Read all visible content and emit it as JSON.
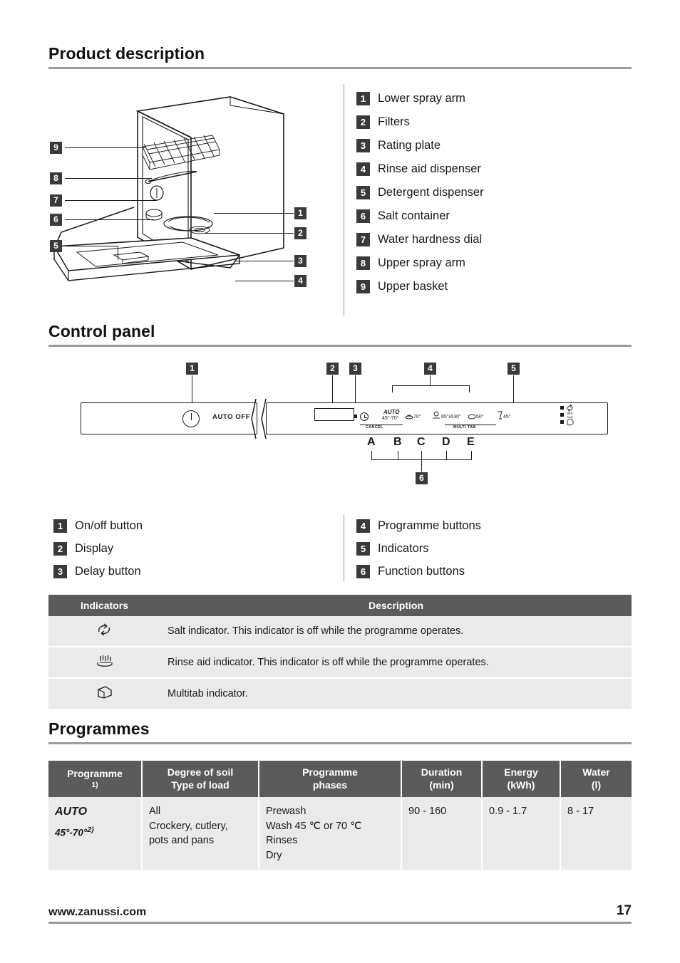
{
  "sections": {
    "product_description": "Product description",
    "control_panel": "Control panel",
    "programmes": "Programmes"
  },
  "product_legend": [
    {
      "n": "1",
      "label": "Lower spray arm"
    },
    {
      "n": "2",
      "label": "Filters"
    },
    {
      "n": "3",
      "label": "Rating plate"
    },
    {
      "n": "4",
      "label": "Rinse aid dispenser"
    },
    {
      "n": "5",
      "label": "Detergent dispenser"
    },
    {
      "n": "6",
      "label": "Salt container"
    },
    {
      "n": "7",
      "label": "Water hardness dial"
    },
    {
      "n": "8",
      "label": "Upper spray arm"
    },
    {
      "n": "9",
      "label": "Upper basket"
    }
  ],
  "diagram_callouts": {
    "left": [
      "9",
      "8",
      "7",
      "6",
      "5"
    ],
    "right": [
      "1",
      "2",
      "3",
      "4"
    ]
  },
  "control_panel": {
    "callouts": [
      "1",
      "2",
      "3",
      "4",
      "5",
      "6"
    ],
    "letters": [
      "A",
      "B",
      "C",
      "D",
      "E"
    ],
    "panel_labels": {
      "auto_off": "AUTO OFF",
      "auto": "AUTO",
      "auto_range": "45°-70°",
      "p70": "70°",
      "p65a30": "65°/A30°",
      "p50": "50°",
      "p45": "45°",
      "cancel": "CANCEL",
      "multitab": "MULTI TAB"
    },
    "legend_left": [
      {
        "n": "1",
        "label": "On/off button"
      },
      {
        "n": "2",
        "label": "Display"
      },
      {
        "n": "3",
        "label": "Delay button"
      }
    ],
    "legend_right": [
      {
        "n": "4",
        "label": "Programme buttons"
      },
      {
        "n": "5",
        "label": "Indicators"
      },
      {
        "n": "6",
        "label": "Function buttons"
      }
    ]
  },
  "indicators_table": {
    "headers": [
      "Indicators",
      "Description"
    ],
    "rows": [
      {
        "icon": "salt-indicator-icon",
        "description": "Salt indicator. This indicator is off while the programme operates."
      },
      {
        "icon": "rinse-aid-indicator-icon",
        "description": "Rinse aid indicator. This indicator is off while the programme operates."
      },
      {
        "icon": "multitab-indicator-icon",
        "description": "Multitab indicator."
      }
    ]
  },
  "programmes_table": {
    "headers": [
      {
        "l1": "Programme",
        "l2": "",
        "sup": "1)"
      },
      {
        "l1": "Degree of soil",
        "l2": "Type of load",
        "sup": ""
      },
      {
        "l1": "Programme",
        "l2": "phases",
        "sup": ""
      },
      {
        "l1": "Duration",
        "l2": "(min)",
        "sup": ""
      },
      {
        "l1": "Energy",
        "l2": "(kWh)",
        "sup": ""
      },
      {
        "l1": "Water",
        "l2": "(l)",
        "sup": ""
      }
    ],
    "rows": [
      {
        "programme_name": "AUTO",
        "programme_temp": "45°-70°",
        "programme_sup": "2)",
        "soil": [
          "All",
          "Crockery, cutlery,",
          "pots and pans"
        ],
        "phases": [
          "Prewash",
          "Wash 45 ℃ or 70 ℃",
          "Rinses",
          "Dry"
        ],
        "duration": "90 - 160",
        "energy": "0.9 - 1.7",
        "water": "8 - 17"
      }
    ]
  },
  "footer": {
    "website": "www.zanussi.com",
    "page_number": "17"
  }
}
